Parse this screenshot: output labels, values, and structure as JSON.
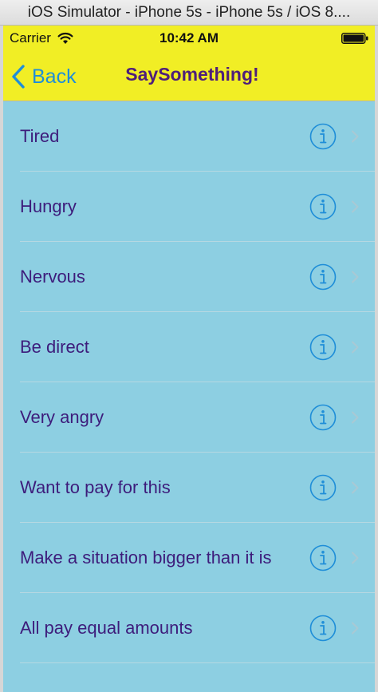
{
  "window": {
    "title": "iOS Simulator - iPhone 5s - iPhone 5s / iOS 8...."
  },
  "status_bar": {
    "carrier": "Carrier",
    "time": "10:42 AM",
    "wifi_icon": "wifi-icon",
    "battery_icon": "battery-icon"
  },
  "nav_bar": {
    "back_label": "Back",
    "title": "SaySomething!",
    "background_color": "#f1ee25",
    "title_color": "#4e1e7a",
    "back_color": "#1f8ed8"
  },
  "table": {
    "background_color": "#8dcfe2",
    "text_color": "#3d1c7b",
    "accessory_icons": [
      "info-icon",
      "chevron-right-icon"
    ],
    "rows": [
      {
        "label": "Tired"
      },
      {
        "label": "Hungry"
      },
      {
        "label": "Nervous"
      },
      {
        "label": "Be direct"
      },
      {
        "label": "Very angry"
      },
      {
        "label": "Want to pay for this"
      },
      {
        "label": "Make a situation bigger than it is"
      },
      {
        "label": "All pay equal amounts"
      }
    ]
  }
}
